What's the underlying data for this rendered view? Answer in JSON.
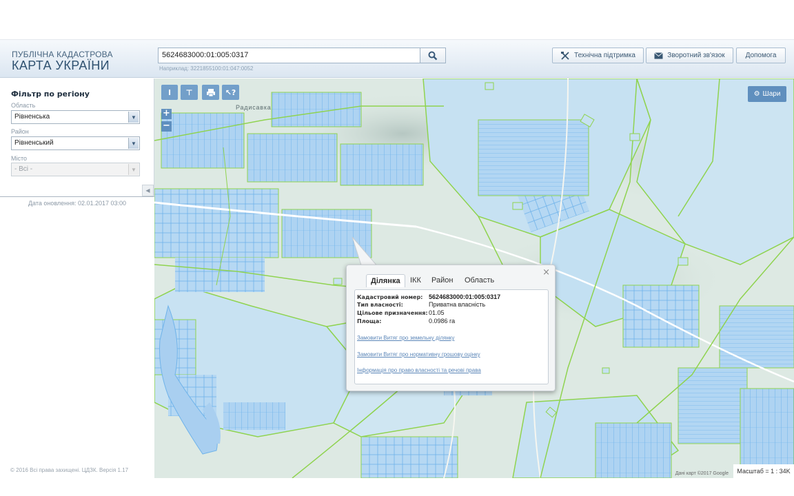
{
  "header": {
    "brand_small": "ПУБЛІЧНА КАДАСТРОВА",
    "brand_big": "КАРТА УКРАЇНИ",
    "search_value": "5624683000:01:005:0317",
    "search_hint": "Наприклад: 3221855100:01:047:0052",
    "support_label": "Технічна підтримка",
    "feedback_label": "Зворотний зв'язок",
    "help_label": "Допомога"
  },
  "filter": {
    "title": "Фільтр по регіону",
    "region_label": "Область",
    "region_value": "Рівненська",
    "district_label": "Район",
    "district_value": "Рівненський",
    "city_label": "Місто",
    "city_value": "- Всі -"
  },
  "update_date": "Дата оновлення: 02.01.2017 03:00",
  "copyright": "© 2016 Всі права захищені. ЦДЗК. Версія 1.17",
  "map": {
    "village_label": "Радисавка",
    "layers_label": "Шари",
    "scale": "Масштаб = 1 : 34K",
    "attribution": "Дані карт ©2017 Google",
    "zoom_in": "+",
    "zoom_out": "−"
  },
  "popup": {
    "tabs": [
      "Ділянка",
      "ІКК",
      "Район",
      "Область"
    ],
    "rows": [
      {
        "key": "Кадастровий номер:",
        "value": "5624683000:01:005:0317"
      },
      {
        "key": "Тип власності:",
        "value": "Приватна власність"
      },
      {
        "key": "Цільове призначення:",
        "value": "01.05"
      },
      {
        "key": "Площа:",
        "value": "0.0986 га"
      }
    ],
    "links": [
      "Замовити Витяг про земельну ділянку",
      "Замовити Витяг про нормативну грошову оцінку",
      "Інформація про право власності та речові права"
    ]
  },
  "colors": {
    "parcel_fill": "#aed3f2",
    "parcel_stroke": "#6fb3ea",
    "boundary": "#8fd34f",
    "terrain": "#dde9e3",
    "water": "#a9cff0",
    "accent": "#5688ba"
  }
}
